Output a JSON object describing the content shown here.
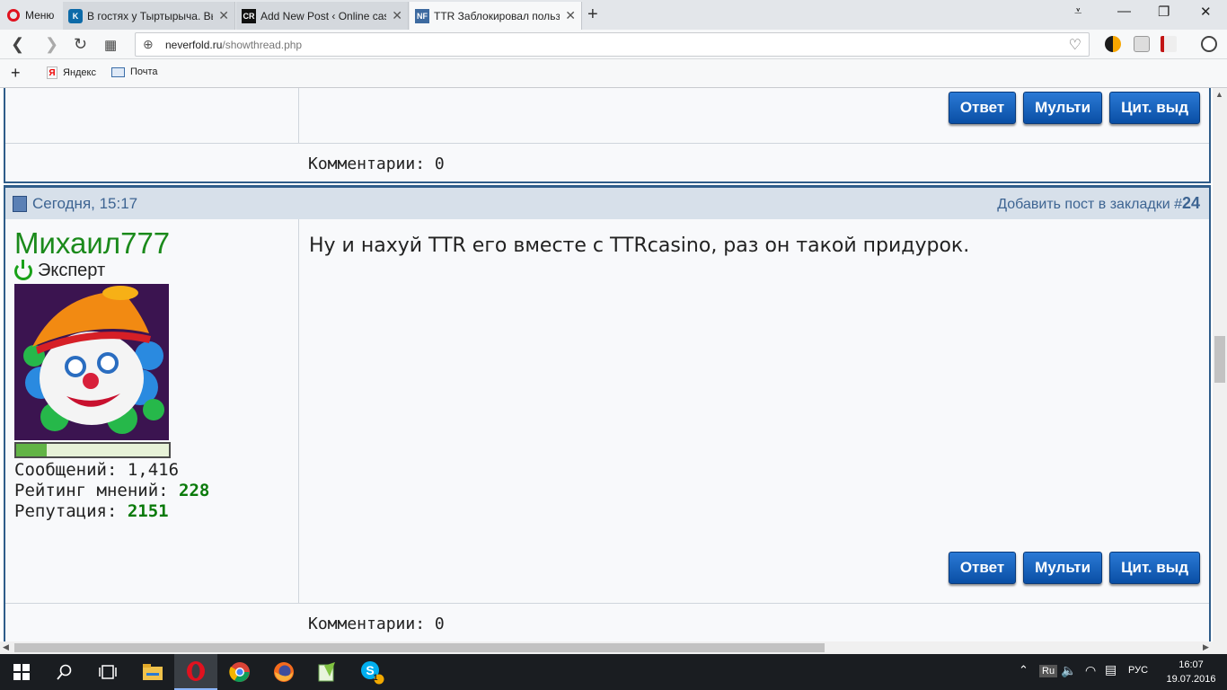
{
  "browser": {
    "menu_label": "Меню",
    "tabs": [
      {
        "title": "В гостях у Тыртырыча. Вынос",
        "favicon_text": "K"
      },
      {
        "title": "Add New Post ‹ Online casino",
        "favicon_text": "CR"
      },
      {
        "title": "TTR Заблокировал пользователя",
        "favicon_text": "NF"
      }
    ],
    "url_host": "neverfold.ru",
    "url_path": "/showthread.php",
    "bookmarks": [
      {
        "label": "Яндекс",
        "icon": "yandex-icon"
      },
      {
        "label": "Почта",
        "icon": "mail-icon"
      }
    ]
  },
  "prev_post": {
    "buttons": {
      "reply": "Ответ",
      "multi": "Мульти",
      "quote": "Цит. выд"
    },
    "comments": "Комментарии: 0"
  },
  "post": {
    "date": "Сегодня, 15:17",
    "bookmark_label": "Добавить пост в закладки #",
    "post_number": "24",
    "username": "Михаил777",
    "user_title": "Эксперт",
    "reputation_fill": 0.2,
    "stats": {
      "messages_label": "Сообщений:",
      "messages_value": "1,416",
      "rating_label": "Рейтинг мнений:",
      "rating_value": "228",
      "reputation_label": "Репутация:",
      "reputation_value": "2151"
    },
    "message": "Ну и нахуй TTR его вместе с TTRcasino, раз он такой придурок.",
    "buttons": {
      "reply": "Ответ",
      "multi": "Мульти",
      "quote": "Цит. выд"
    },
    "comments": "Комментарии: 0"
  },
  "taskbar": {
    "lang_badge": "Ru",
    "lang": "РУС",
    "time": "16:07",
    "date": "19.07.2016",
    "skype_badge": "1"
  },
  "colors": {
    "accent": "#2f5d8a",
    "username": "#1b8a1b",
    "button": "#0a4fa5"
  }
}
